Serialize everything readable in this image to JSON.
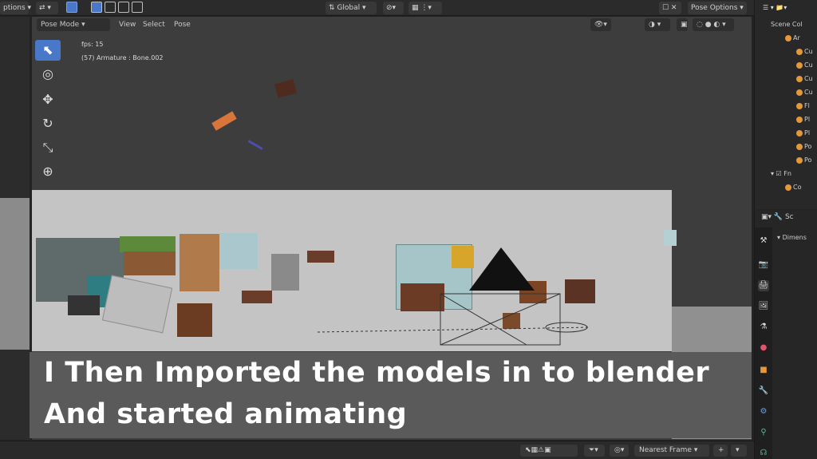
{
  "topbar": {
    "left_menu": "ptions",
    "orientation": "Global",
    "options": "Pose Options"
  },
  "header": {
    "mode": "Pose Mode",
    "menu": [
      "View",
      "Select",
      "Pose"
    ]
  },
  "viewport": {
    "fps_label": "fps: 15",
    "object_label": "(57) Armature : Bone.002"
  },
  "caption": {
    "line1": "I Then Imported the models in to blender",
    "line2": "And started animating"
  },
  "outliner": {
    "title": "Scene Col",
    "rows": [
      "Ar",
      "Cu",
      "Cu",
      "Cu",
      "Cu",
      "Fl",
      "Pl",
      "Pl",
      "Po",
      "Po",
      "Fn",
      "Co"
    ]
  },
  "properties": {
    "panel_label": "Dimens",
    "scene_label": "Sc"
  },
  "statusbar": {
    "snap": "Nearest Frame"
  },
  "colors": {
    "accent": "#4a78c9",
    "orange": "#e6973a"
  }
}
